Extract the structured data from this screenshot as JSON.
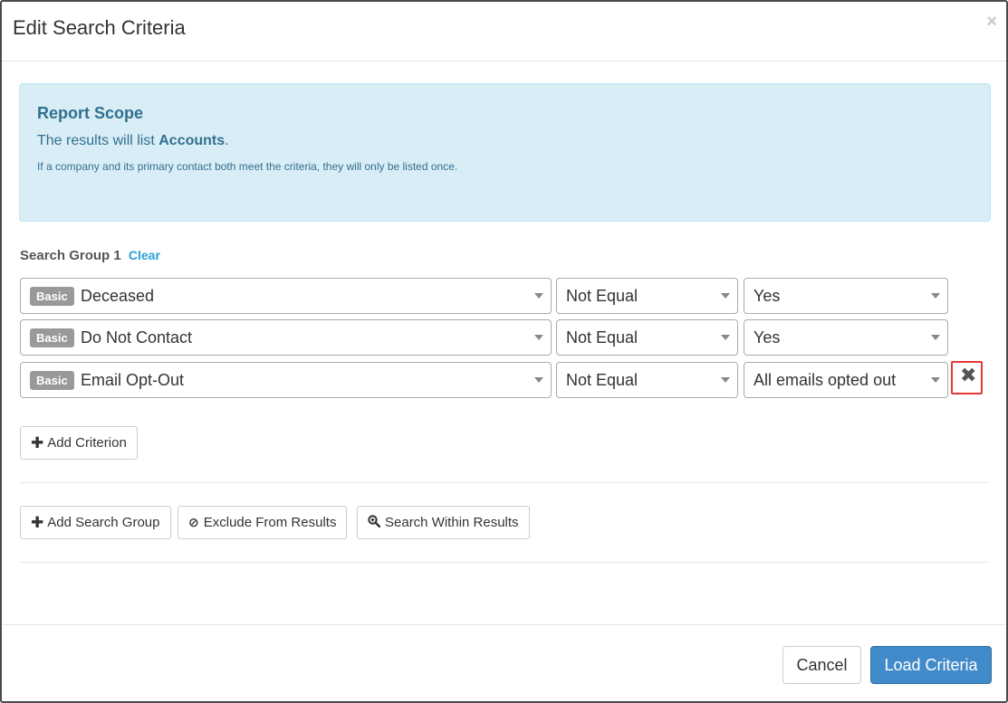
{
  "modal": {
    "title": "Edit Search Criteria",
    "close_symbol": "×"
  },
  "scope": {
    "title": "Report Scope",
    "line_prefix": "The results will list ",
    "line_entity": "Accounts",
    "line_suffix": ".",
    "note": "If a company and its primary contact both meet the criteria, they will only be listed once."
  },
  "group": {
    "label": "Search Group 1",
    "clear_label": "Clear",
    "criteria": [
      {
        "badge": "Basic",
        "field": "Deceased",
        "operator": "Not Equal",
        "value": "Yes"
      },
      {
        "badge": "Basic",
        "field": "Do Not Contact",
        "operator": "Not Equal",
        "value": "Yes"
      },
      {
        "badge": "Basic",
        "field": "Email Opt-Out",
        "operator": "Not Equal",
        "value": "All emails opted out"
      }
    ],
    "remove_symbol": "✖",
    "add_criterion_label": "Add Criterion"
  },
  "actions": {
    "add_group_label": "Add Search Group",
    "exclude_label": "Exclude From Results",
    "within_label": "Search Within Results"
  },
  "icons": {
    "plus": "plus-icon",
    "ban": "ban-icon",
    "zoom": "zoom-in-icon",
    "remove": "remove-icon",
    "caret": "caret-down-icon"
  },
  "footer": {
    "cancel_label": "Cancel",
    "load_label": "Load Criteria"
  },
  "colors": {
    "info_bg": "#d9edf7",
    "info_text": "#31708f",
    "primary": "#428bca",
    "link": "#2a9fd6",
    "highlight": "#e53935"
  }
}
